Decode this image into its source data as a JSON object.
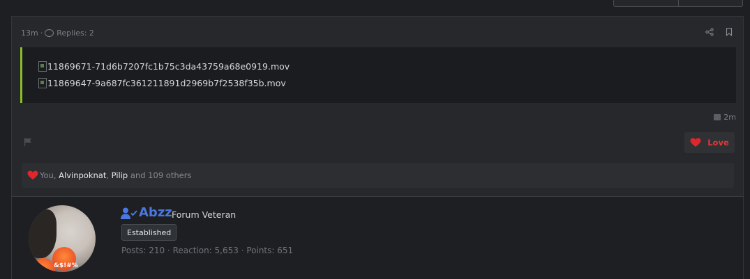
{
  "post": {
    "time": "13m",
    "meta_separator": "·",
    "replies": "Replies: 2",
    "attachments": [
      "11869671-71d6b7207fc1b75c3da43759a68e0919.mov",
      "11869647-9a687fc361211891d2969b7f2538f35b.mov"
    ],
    "edited_time": "2m",
    "love_button_label": "Love",
    "reactions": {
      "prefix": "You,",
      "users": [
        "Alvinpoknat",
        "Pilip"
      ],
      "separator": ",",
      "suffix": "and 109 others"
    }
  },
  "author": {
    "username": "Abzz",
    "title": "Forum Veteran",
    "badge": "Established",
    "avatar_text": "&$!#%",
    "stats": "Posts: 210 · Reaction: 5,653 · Points: 651"
  },
  "colors": {
    "accent_quote": "#8bbd2a",
    "love": "#e03a3a",
    "username": "#4a78e0"
  },
  "icons": [
    "share-icon",
    "bookmark-icon",
    "flag-icon",
    "heart-icon",
    "user-check-icon",
    "speech-bubble-icon"
  ]
}
